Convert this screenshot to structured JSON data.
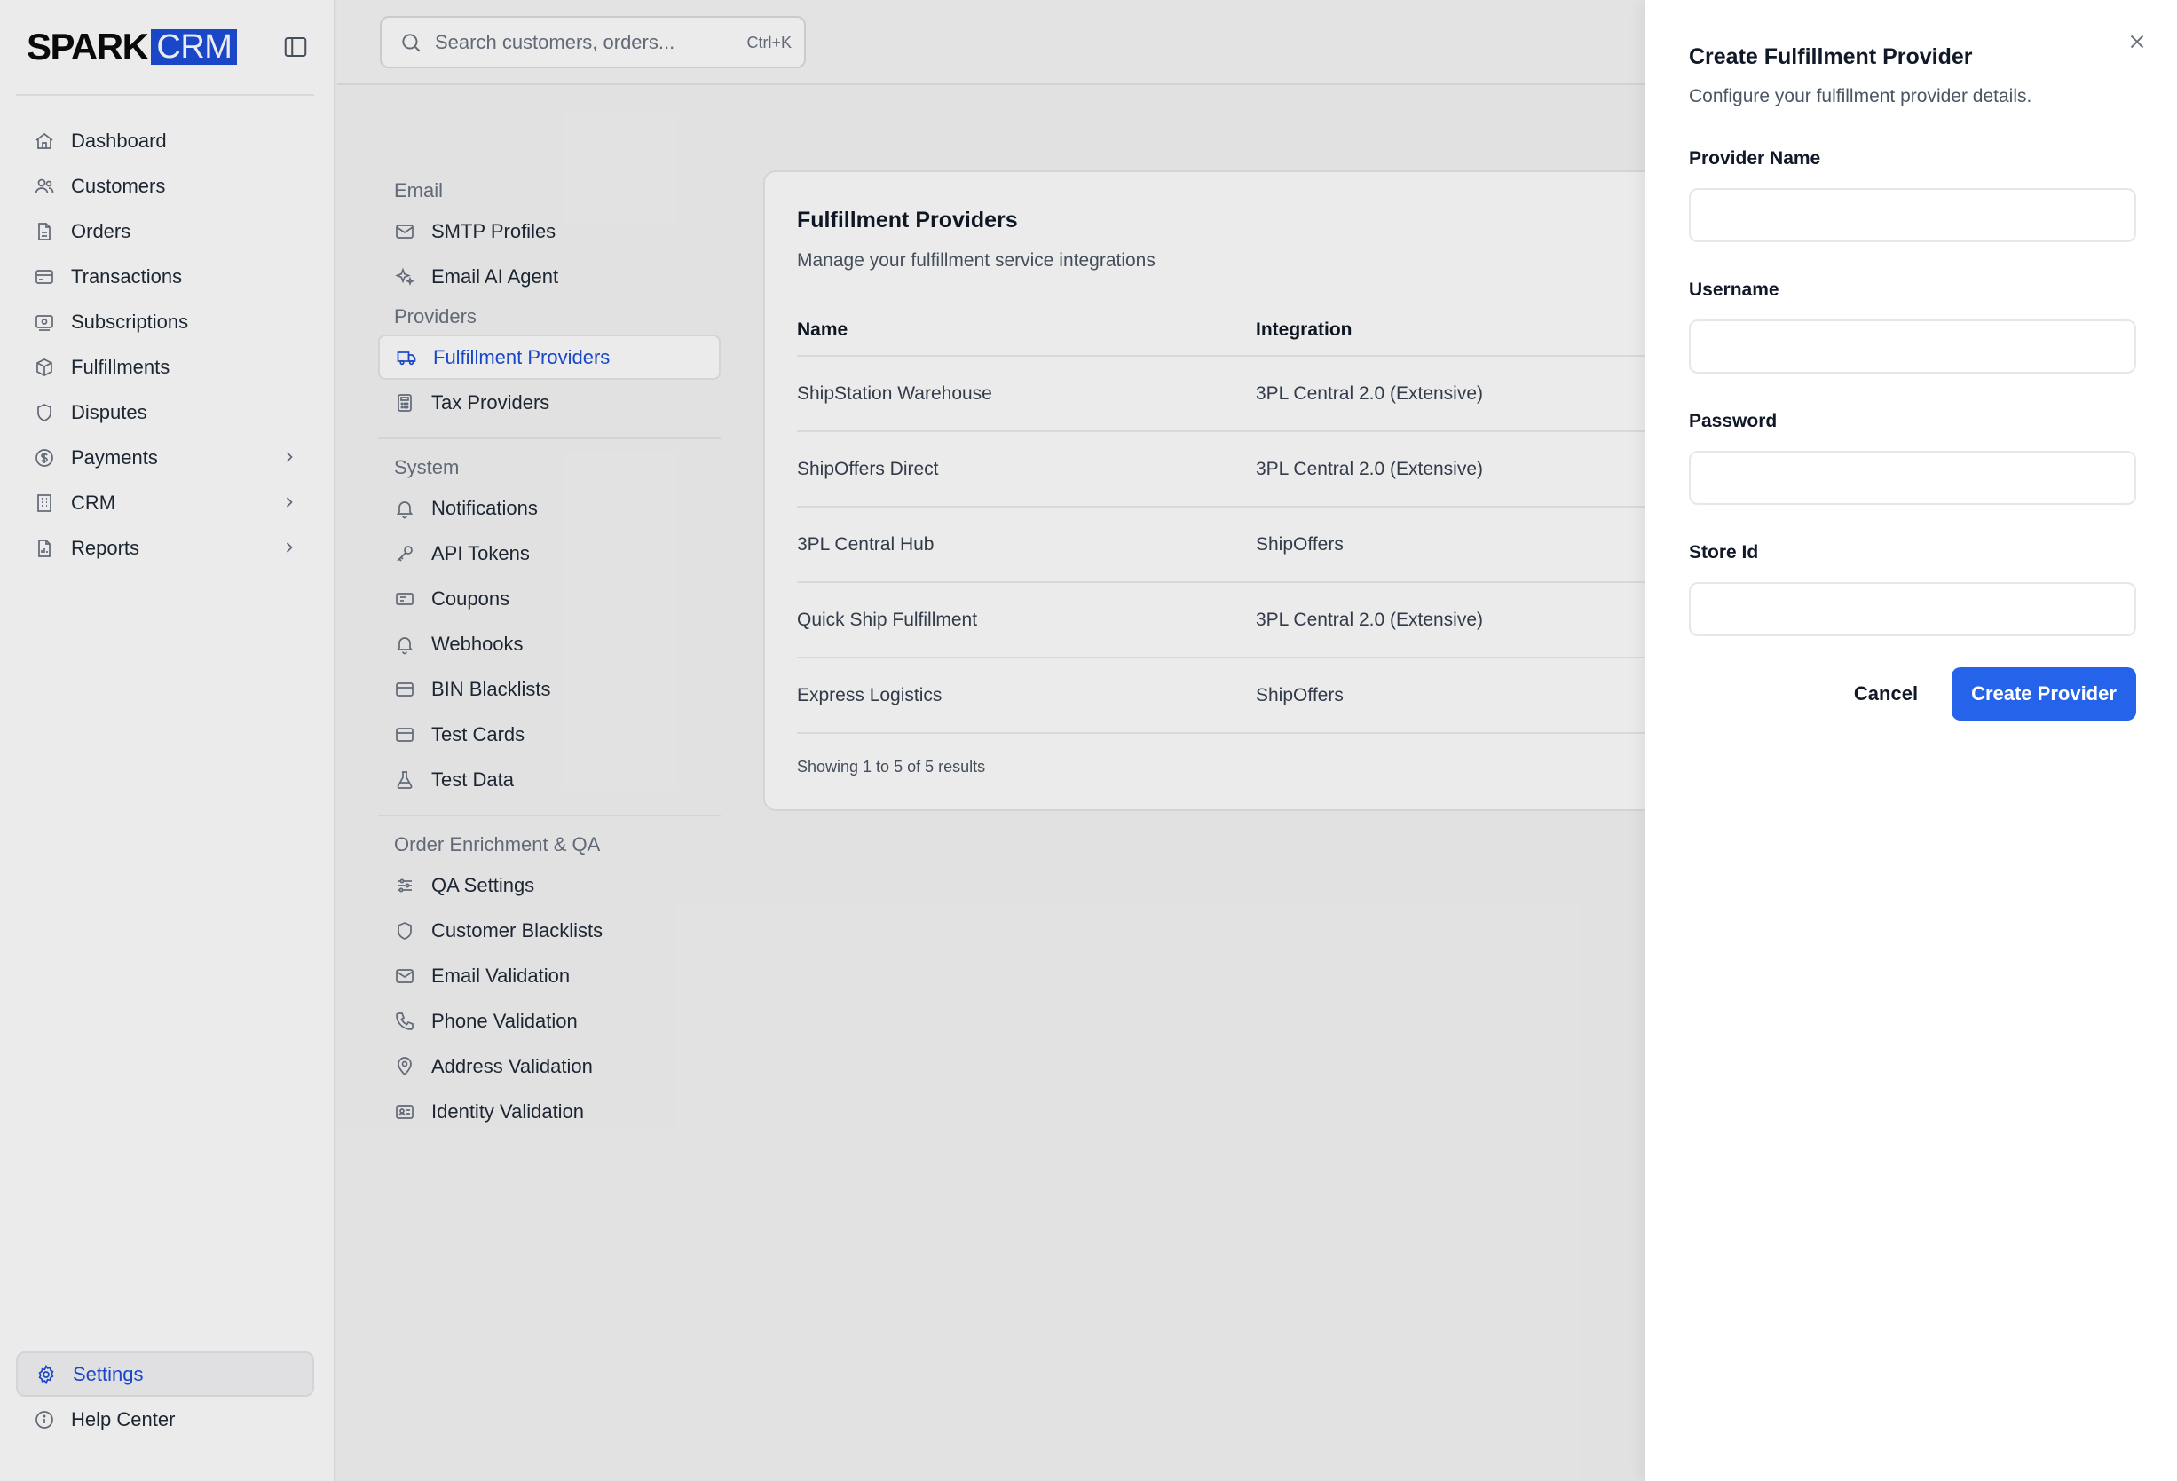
{
  "brand": {
    "part1": "SPARK",
    "part2": "CRM",
    "accent": "#1d4ed8"
  },
  "sidebar": {
    "items": [
      {
        "label": "Dashboard",
        "icon": "home-icon"
      },
      {
        "label": "Customers",
        "icon": "users-icon"
      },
      {
        "label": "Orders",
        "icon": "file-icon"
      },
      {
        "label": "Transactions",
        "icon": "credit-card-icon"
      },
      {
        "label": "Subscriptions",
        "icon": "banknote-icon"
      },
      {
        "label": "Fulfillments",
        "icon": "package-icon"
      },
      {
        "label": "Disputes",
        "icon": "shield-icon"
      },
      {
        "label": "Payments",
        "icon": "dollar-circle-icon",
        "expandable": true
      },
      {
        "label": "CRM",
        "icon": "building-icon",
        "expandable": true
      },
      {
        "label": "Reports",
        "icon": "report-icon",
        "expandable": true
      }
    ],
    "bottom": [
      {
        "label": "Settings",
        "icon": "gear-icon",
        "active": true
      },
      {
        "label": "Help Center",
        "icon": "info-icon"
      }
    ]
  },
  "search": {
    "placeholder": "Search customers, orders...",
    "shortcut": "Ctrl+K"
  },
  "settings_nav": {
    "groups": [
      {
        "title": "Email",
        "items": [
          {
            "label": "SMTP Profiles"
          },
          {
            "label": "Email AI Agent"
          }
        ]
      },
      {
        "title": "Providers",
        "items": [
          {
            "label": "Fulfillment Providers",
            "active": true
          },
          {
            "label": "Tax Providers"
          }
        ]
      },
      {
        "title": "System",
        "items": [
          {
            "label": "Notifications"
          },
          {
            "label": "API Tokens"
          },
          {
            "label": "Coupons"
          },
          {
            "label": "Webhooks"
          },
          {
            "label": "BIN Blacklists"
          },
          {
            "label": "Test Cards"
          },
          {
            "label": "Test Data"
          }
        ]
      },
      {
        "title": "Order Enrichment & QA",
        "items": [
          {
            "label": "QA Settings"
          },
          {
            "label": "Customer Blacklists"
          },
          {
            "label": "Email Validation"
          },
          {
            "label": "Phone Validation"
          },
          {
            "label": "Address Validation"
          },
          {
            "label": "Identity Validation"
          }
        ]
      }
    ]
  },
  "card": {
    "title": "Fulfillment Providers",
    "subtitle": "Manage your fulfillment service integrations",
    "columns": [
      "Name",
      "Integration"
    ],
    "rows": [
      {
        "name": "ShipStation Warehouse",
        "integration": "3PL Central 2.0 (Extensive)"
      },
      {
        "name": "ShipOffers Direct",
        "integration": "3PL Central 2.0 (Extensive)"
      },
      {
        "name": "3PL Central Hub",
        "integration": "ShipOffers"
      },
      {
        "name": "Quick Ship Fulfillment",
        "integration": "3PL Central 2.0 (Extensive)"
      },
      {
        "name": "Express Logistics",
        "integration": "ShipOffers"
      }
    ],
    "footer": "Showing 1 to 5 of 5 results"
  },
  "panel": {
    "title": "Create Fulfillment Provider",
    "subtitle": "Configure your fulfillment provider details.",
    "fields": [
      {
        "label": "Provider Name",
        "value": ""
      },
      {
        "label": "Username",
        "value": ""
      },
      {
        "label": "Password",
        "value": ""
      },
      {
        "label": "Store Id",
        "value": ""
      }
    ],
    "cancel_label": "Cancel",
    "submit_label": "Create Provider",
    "submit_color": "#2563eb"
  }
}
